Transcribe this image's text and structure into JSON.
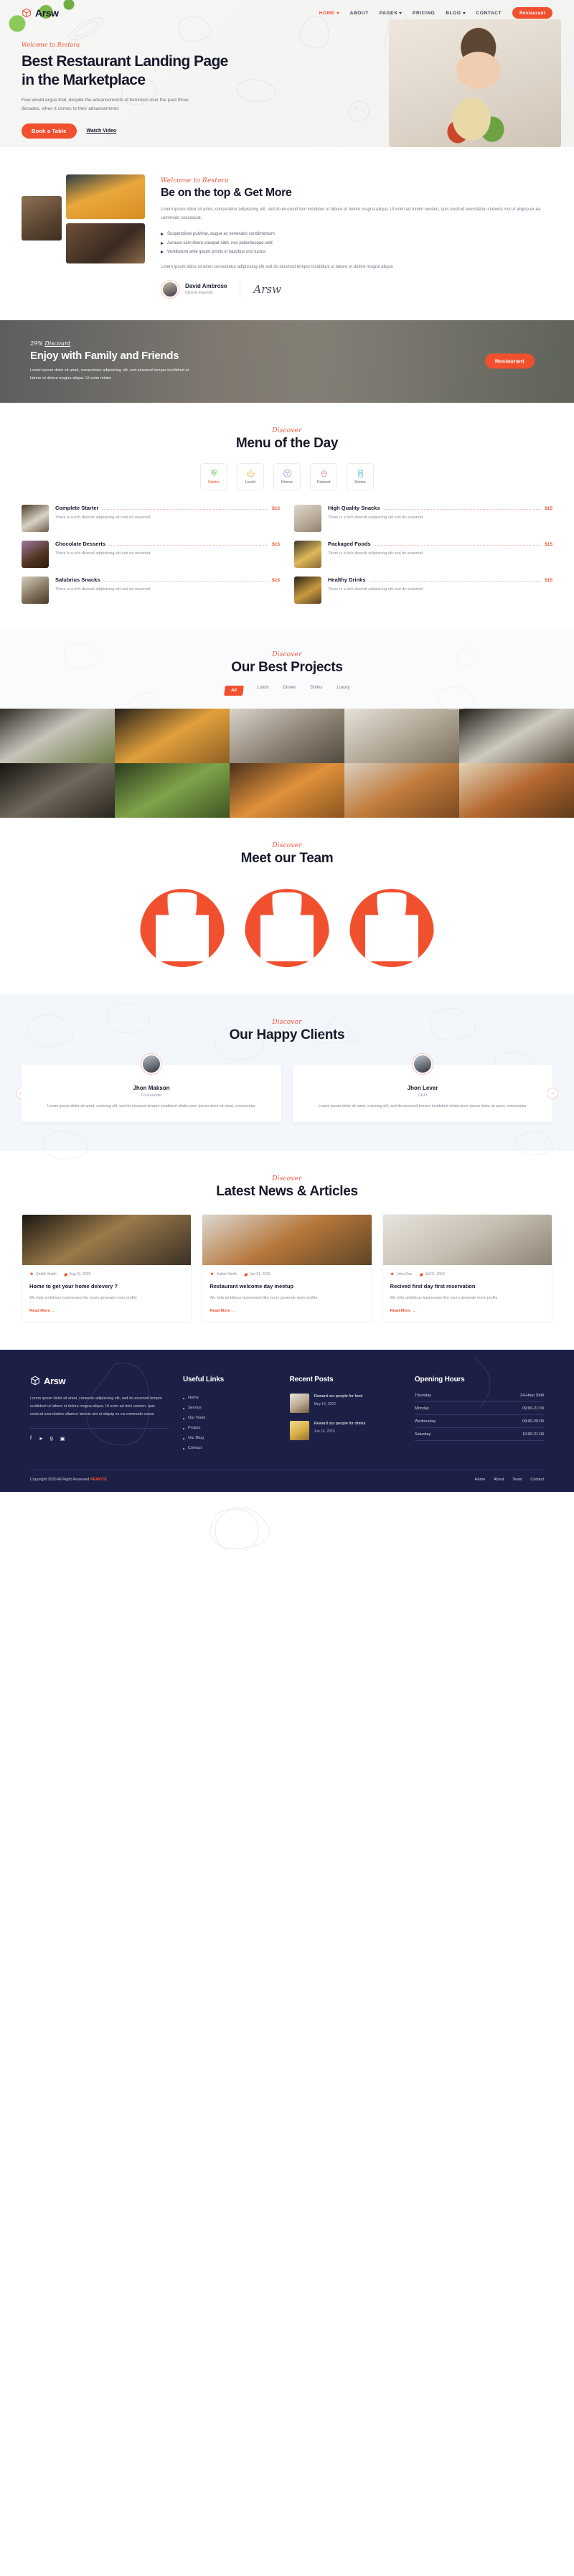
{
  "brand": {
    "name": "Arsw",
    "icon": "cube-icon"
  },
  "nav": {
    "items": [
      {
        "label": "HOME",
        "has_caret": true,
        "active": true
      },
      {
        "label": "ABOUT",
        "has_caret": false,
        "active": false
      },
      {
        "label": "PAGES",
        "has_caret": true,
        "active": false
      },
      {
        "label": "PRICING",
        "has_caret": false,
        "active": false
      },
      {
        "label": "BLOG",
        "has_caret": true,
        "active": false
      },
      {
        "label": "CONTACT",
        "has_caret": false,
        "active": false
      }
    ],
    "cta": "Restaurant"
  },
  "hero": {
    "kicker": "Welcome to Restora",
    "title_line1": "Best Restaurant Landing Page",
    "title_line2": "in the Marketplace",
    "text": "Few would argue that, despite the advancements of feminism over the past three decades, when it comes to their advancements",
    "primary_button": "Book a Table",
    "secondary_link": "Watch Video"
  },
  "about": {
    "kicker": "Welcome to Restora",
    "title": "Be on the top & Get More",
    "paragraph": "Lorem ipsum dolor sit amet, consectetur adipisicing elit, sed do eiusmod tem incididun ut labore et dolore magna aliqua. Ut enim ad minim veniam, quis nostrud exercitatio u laboris nisi ut aliquip ex ea commodo consequat.",
    "bullets": [
      "Suspendisse pulvinar, augue ac venenatis condimentum",
      "Aenean sem libero volutpat nibh, nec pellentesque velit",
      "Vestibulum ante ipsum primis in faucibus orci luctus"
    ],
    "paragraph2": "Lorem ipsum dolor sit amet consectetur adipisicing elit sed do eiusmod tempor incididunt ut labore et dolore magna aliqua",
    "author_name": "David Ambrose",
    "author_role": "CEO & Founder",
    "signature": "Arsw"
  },
  "promo": {
    "kicker_pct": "29% ",
    "kicker_word": "Discount",
    "title": "Enjoy with Family and Friends",
    "text": "Lorem ipsum dolor sit amet, consectetur adipisicing elit, sed eiusmod tempor incididunt ut labore et dolore magna aliqua. Ut enim minim",
    "button": "Restaurant"
  },
  "menu": {
    "kicker": "Discover",
    "title": "Menu of the Day",
    "tabs": [
      {
        "label": "Starter",
        "icon": "broccoli-icon",
        "active": true
      },
      {
        "label": "Lunch",
        "icon": "noodle-bowl-icon",
        "active": false
      },
      {
        "label": "Dinner",
        "icon": "pizza-icon",
        "active": false
      },
      {
        "label": "Dessert",
        "icon": "cupcake-icon",
        "active": false
      },
      {
        "label": "Drinks",
        "icon": "juice-cup-icon",
        "active": false
      }
    ],
    "items": [
      {
        "name": "Complete Starter",
        "price": "$15",
        "desc": "There is a rich diversit adipisicing elit sed do eiusmod"
      },
      {
        "name": "High Quality Snacks",
        "price": "$15",
        "desc": "There is a rich diversit adipisicing elit sed do eiusmod"
      },
      {
        "name": "Chocolate Desserts",
        "price": "$15",
        "desc": "There is a rich diversit adipisicing elit sed do eiusmod"
      },
      {
        "name": "Packaged Foods",
        "price": "$15",
        "desc": "There is a rich diversit adipisicing elit sed do eiusmod"
      },
      {
        "name": "Salubrius Snacks",
        "price": "$15",
        "desc": "There is a rich diversit adipisicing elit sed do eiusmod"
      },
      {
        "name": "Healthy Drinks",
        "price": "$15",
        "desc": "There is a rich diversit adipisicing elit sed do eiusmod"
      }
    ]
  },
  "projects": {
    "kicker": "Discover",
    "title": "Our Best Projects",
    "filters": [
      {
        "label": "All",
        "active": true
      },
      {
        "label": "Lunch",
        "active": false
      },
      {
        "label": "Dinner",
        "active": false
      },
      {
        "label": "Drinks",
        "active": false
      },
      {
        "label": "Luxury",
        "active": false
      }
    ]
  },
  "team": {
    "kicker": "Discover",
    "title": "Meet our Team"
  },
  "clients": {
    "kicker": "Discover",
    "title": "Our Happy Clients",
    "prev_icon": "arrow-left-icon",
    "next_icon": "arrow-right-icon",
    "items": [
      {
        "name": "Jhon Makson",
        "role": "Co-Founder",
        "text": "Lorem ipsum dolor sit amet, cuisicing elit, sed do eiusmod tempor incididunt utlabLorem ipsum dolor sit amet, consectetur"
      },
      {
        "name": "Jhon Lever",
        "role": "CEO",
        "text": "Lorem ipsum dolor sit amet, cuisicing elit, sed do eiusmod tempor incididunt utlabLorem ipsum dolor sit amet, consectetur"
      }
    ]
  },
  "blog": {
    "kicker": "Discover",
    "title": "Latest News & Articles",
    "posts": [
      {
        "author": "Endith Smith",
        "date": "Aug 01, 2020",
        "title": "Home to get your home delevery ?",
        "text": "We help ambitious businesses like yours generate more profits",
        "read_more": "Read More"
      },
      {
        "author": "Kathie Smith",
        "date": "Jun 01, 2020",
        "title": "Restaurant welcome day meetup",
        "text": "We help ambitious businesses like yours generate more profits",
        "read_more": "Read More"
      },
      {
        "author": "John Doe",
        "date": "Jul 01, 2020",
        "title": "Recived first day first reservation",
        "text": "We help ambitious businesses like yours generate more profits",
        "read_more": "Read More"
      }
    ]
  },
  "footer": {
    "brand": "Arsw",
    "about": "Lorem ipsum dolor sit amet, consecte adipisicing elit, sed do eiusmod tempor incididunt ut labore et dolore magna aliqua. Ut enim ad mini veniam, quis nostrud exercitation ullamco laboris nisi ut aliquip ex ea commodo conse",
    "social": [
      {
        "icon": "facebook-icon",
        "glyph": "f"
      },
      {
        "icon": "twitter-icon",
        "glyph": "➤"
      },
      {
        "icon": "google-plus-icon",
        "glyph": "g"
      },
      {
        "icon": "instagram-icon",
        "glyph": "▣"
      }
    ],
    "links_title": "Useful Links",
    "links": [
      "Home",
      "Service",
      "Our Team",
      "Project",
      "Our Blog",
      "Contact"
    ],
    "posts_title": "Recent Posts",
    "posts": [
      {
        "title": "Reward our people for food",
        "date": "May 14, 2020"
      },
      {
        "title": "Reward our people for drinks",
        "date": "Jun 14, 2020"
      }
    ],
    "hours_title": "Opening Hours",
    "hours": [
      {
        "day": "Thursday",
        "time": "24-Hour Shift"
      },
      {
        "day": "Monday",
        "time": "09:00-21:00"
      },
      {
        "day": "Wednesday",
        "time": "09:00-20:00"
      },
      {
        "day": "Saturday",
        "time": "10:00-21:00"
      }
    ],
    "copyright": "Copyright 2020 All Right Reserved",
    "copyright_brand": "REMOTE",
    "bottom_links": [
      "Home",
      "About",
      "Team",
      "Contact"
    ]
  },
  "colors": {
    "accent": "#f1502f",
    "dark": "#17192b",
    "footer_bg": "#1d2046",
    "muted": "#8a8d9c"
  }
}
